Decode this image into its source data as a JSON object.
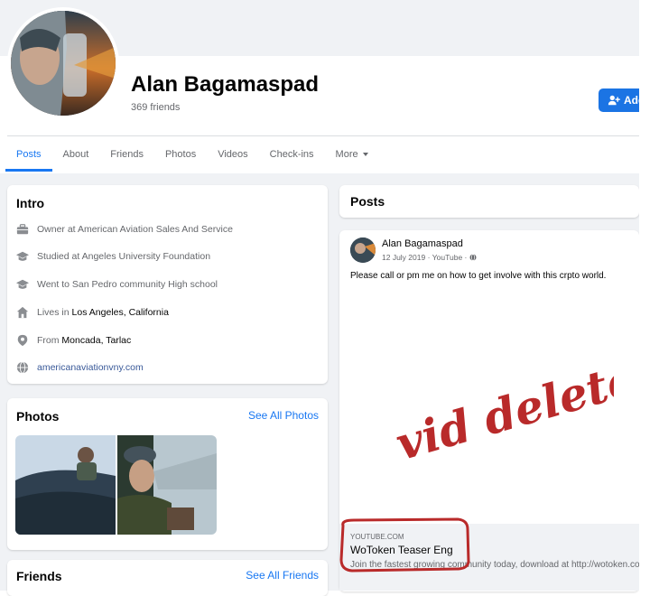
{
  "profile": {
    "name": "Alan Bagamaspad",
    "friends_count": "369 friends",
    "add_button": "Add"
  },
  "tabs": [
    {
      "label": "Posts",
      "active": true
    },
    {
      "label": "About"
    },
    {
      "label": "Friends"
    },
    {
      "label": "Photos"
    },
    {
      "label": "Videos"
    },
    {
      "label": "Check-ins"
    },
    {
      "label": "More"
    }
  ],
  "intro": {
    "title": "Intro",
    "items": [
      {
        "icon": "briefcase-icon",
        "text": "Owner at American Aviation Sales And Service"
      },
      {
        "icon": "graduation-cap-icon",
        "text": "Studied at Angeles University Foundation"
      },
      {
        "icon": "graduation-cap-icon",
        "text": "Went to San Pedro community High school"
      },
      {
        "icon": "home-icon",
        "prefix": "Lives in ",
        "bold": "Los Angeles, California"
      },
      {
        "icon": "location-pin-icon",
        "prefix": "From ",
        "bold": "Moncada, Tarlac"
      },
      {
        "icon": "globe-icon",
        "link": "americanaviationvny.com"
      }
    ]
  },
  "photos": {
    "title": "Photos",
    "see_all": "See All Photos"
  },
  "friends": {
    "title": "Friends",
    "see_all": "See All Friends"
  },
  "posts": {
    "title": "Posts",
    "post": {
      "author": "Alan Bagamaspad",
      "date": "12 July 2019",
      "source": "YouTube",
      "text": "Please call or pm me on how to get involve with this crpto world.",
      "annotation": "vid deleted",
      "link": {
        "domain": "YOUTUBE.COM",
        "title": "WoToken Teaser Eng",
        "description": "Join the fastest growing community today, download at http://wotoken.com"
      }
    }
  },
  "colors": {
    "accent": "#1877f2",
    "button": "#1b74e4",
    "annotation_red": "#b92a2a",
    "page_bg": "#f0f2f5"
  }
}
